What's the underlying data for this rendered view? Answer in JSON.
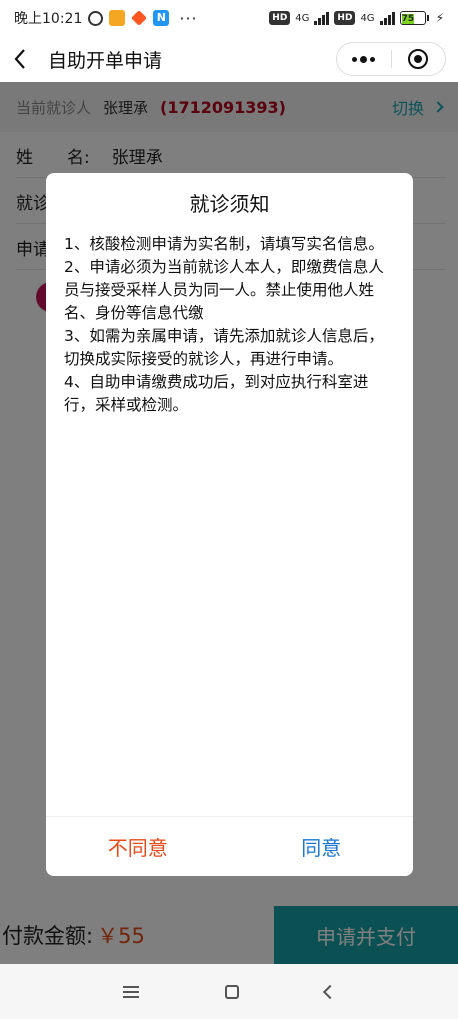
{
  "status_bar": {
    "time": "晚上10:21",
    "more": "···",
    "hd1": "HD",
    "net1": "4G",
    "hd2": "HD",
    "net2": "4G",
    "battery": "75"
  },
  "header": {
    "title": "自助开单申请"
  },
  "patient": {
    "label": "当前就诊人",
    "name": "张理承",
    "id": "(1712091393)",
    "switch_label": "切换"
  },
  "form": {
    "name_label_1": "姓",
    "name_label_2": "名:",
    "name_value": "张理承",
    "row2_label": "就诊",
    "row3_label": "申请"
  },
  "dialog": {
    "title": "就诊须知",
    "items": [
      "1、核酸检测申请为实名制，请填写实名信息。",
      "2、申请必须为当前就诊人本人，即缴费信息人员与接受采样人员为同一人。禁止使用他人姓名、身份等信息代缴",
      "3、如需为亲属申请，请先添加就诊人信息后，切换成实际接受的就诊人，再进行申请。",
      "4、自助申请缴费成功后，到对应执行科室进行，采样或检测。"
    ],
    "disagree_label": "不同意",
    "agree_label": "同意"
  },
  "bottom": {
    "pay_label": "付款金额:",
    "pay_amount": "￥55",
    "submit_label": "申请并支付"
  },
  "colors": {
    "accent": "#17a2a8",
    "danger": "#e64a19",
    "link": "#1976d2",
    "patient_id": "#b4001e"
  }
}
